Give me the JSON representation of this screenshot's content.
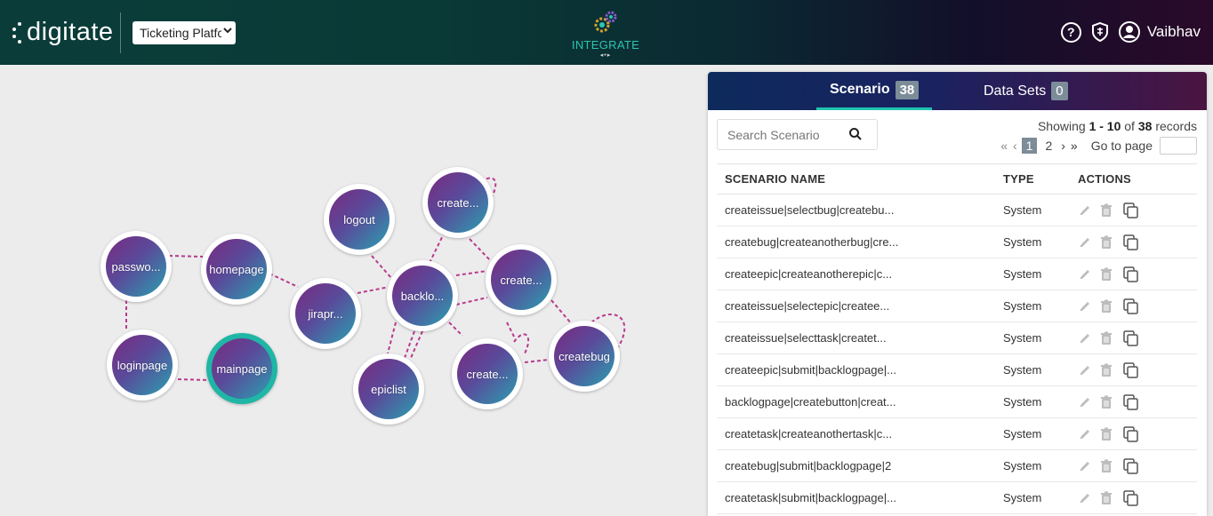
{
  "header": {
    "logo_text": "digitate",
    "project_select": "Ticketing Platfc",
    "integrate_label": "INTEGRATE",
    "integrate_nav": "◂•▸",
    "user_name": "Vaibhav",
    "help_glyph": "?"
  },
  "graph": {
    "nodes": {
      "password": "passwo...",
      "homepage": "homepage",
      "loginpage": "loginpage",
      "mainpage": "mainpage",
      "jirapr": "jirapr...",
      "logout": "logout",
      "backlog": "backlo...",
      "epiclist": "epiclist",
      "create_top": "create...",
      "create_right": "create...",
      "create_bottom": "create...",
      "createbug": "createbug"
    },
    "active_node": "mainpage",
    "node_colors": {
      "gradient_start": "#7a2a80",
      "gradient_end": "#2aa0b0",
      "active_ring": "#1fb6a6",
      "edge": "#b83a8e"
    }
  },
  "panel": {
    "tabs": [
      {
        "label": "Scenario",
        "count": "38"
      },
      {
        "label": "Data Sets",
        "count": "0"
      }
    ],
    "search_placeholder": "Search Scenario",
    "showing_prefix": "Showing",
    "showing_range": "1 - 10",
    "showing_of": "of",
    "showing_total": "38",
    "showing_suffix": "records",
    "pager": {
      "page1": "1",
      "page2": "2",
      "goto_label": "Go to page"
    },
    "columns": {
      "name": "SCENARIO NAME",
      "type": "TYPE",
      "actions": "ACTIONS"
    },
    "rows": [
      {
        "name": "createissue|selectbug|createbu...",
        "type": "System"
      },
      {
        "name": "createbug|createanotherbug|cre...",
        "type": "System"
      },
      {
        "name": "createepic|createanotherepic|c...",
        "type": "System"
      },
      {
        "name": "createissue|selectepic|createe...",
        "type": "System"
      },
      {
        "name": "createissue|selecttask|createt...",
        "type": "System"
      },
      {
        "name": "createepic|submit|backlogpage|...",
        "type": "System"
      },
      {
        "name": "backlogpage|createbutton|creat...",
        "type": "System"
      },
      {
        "name": "createtask|createanothertask|c...",
        "type": "System"
      },
      {
        "name": "createbug|submit|backlogpage|2",
        "type": "System"
      },
      {
        "name": "createtask|submit|backlogpage|...",
        "type": "System"
      }
    ],
    "row_action_icons": [
      "edit-icon",
      "delete-icon",
      "copy-icon"
    ]
  }
}
